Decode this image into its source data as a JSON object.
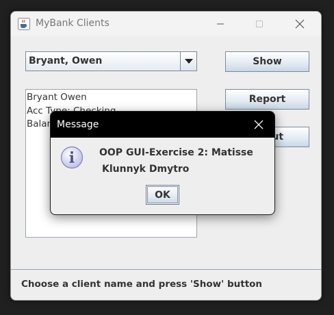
{
  "window": {
    "title": "MyBank Clients",
    "icon": "java-cup-icon"
  },
  "client_select": {
    "selected": "Bryant, Owen"
  },
  "buttons": {
    "show": "Show",
    "report": "Report",
    "about": "About"
  },
  "details": {
    "lines": [
      "Bryant Owen",
      "Acc Type: Checking",
      "Balance:"
    ]
  },
  "status": {
    "text": "Choose a client name and press 'Show' button"
  },
  "dialog": {
    "title": "Message",
    "icon": "info-icon",
    "line1": "OOP GUI-Exercise 2: Matisse",
    "line2": "Klunnyk Dmytro",
    "ok": "OK"
  },
  "colors": {
    "button_gradient_bottom": "#c9d7e6",
    "dialog_titlebar": "#000000",
    "status_separator": "#8fa3c0"
  }
}
